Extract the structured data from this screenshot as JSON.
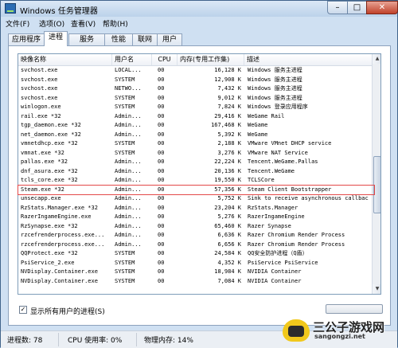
{
  "window": {
    "title": "Windows 任务管理器",
    "minimize_glyph": "–",
    "maximize_glyph": "□",
    "close_glyph": "✕"
  },
  "menu": [
    "文件(F)",
    "选项(O)",
    "查看(V)",
    "帮助(H)"
  ],
  "tabs": [
    "应用程序",
    "进程",
    "服务",
    "性能",
    "联网",
    "用户"
  ],
  "active_tab": "进程",
  "columns": {
    "name": "映像名称",
    "user": "用户名",
    "cpu": "CPU",
    "mem": "内存(专用工作集)",
    "desc": "描述"
  },
  "processes": [
    {
      "name": "svchost.exe",
      "user": "LOCAL...",
      "cpu": "00",
      "mem": "16,128 K",
      "desc": "Windows 服务主进程"
    },
    {
      "name": "svchost.exe",
      "user": "SYSTEM",
      "cpu": "00",
      "mem": "12,908 K",
      "desc": "Windows 服务主进程"
    },
    {
      "name": "svchost.exe",
      "user": "NETWO...",
      "cpu": "00",
      "mem": "7,432 K",
      "desc": "Windows 服务主进程"
    },
    {
      "name": "svchost.exe",
      "user": "SYSTEM",
      "cpu": "00",
      "mem": "9,012 K",
      "desc": "Windows 服务主进程"
    },
    {
      "name": "winlogon.exe",
      "user": "SYSTEM",
      "cpu": "00",
      "mem": "7,824 K",
      "desc": "Windows 登录应用程序"
    },
    {
      "name": "rail.exe *32",
      "user": "Admin...",
      "cpu": "00",
      "mem": "29,416 K",
      "desc": "WeGame Rail"
    },
    {
      "name": "tgp_daemon.exe *32",
      "user": "Admin...",
      "cpu": "00",
      "mem": "167,468 K",
      "desc": "WeGame"
    },
    {
      "name": "net_daemon.exe *32",
      "user": "Admin...",
      "cpu": "00",
      "mem": "5,392 K",
      "desc": "WeGame"
    },
    {
      "name": "vmnetdhcp.exe *32",
      "user": "SYSTEM",
      "cpu": "00",
      "mem": "2,188 K",
      "desc": "VMware VMnet DHCP service"
    },
    {
      "name": "vmnat.exe *32",
      "user": "SYSTEM",
      "cpu": "00",
      "mem": "3,276 K",
      "desc": "VMware NAT Service"
    },
    {
      "name": "pallas.exe *32",
      "user": "Admin...",
      "cpu": "00",
      "mem": "22,224 K",
      "desc": "Tencent.WeGame.Pallas"
    },
    {
      "name": "dnf_asura.exe *32",
      "user": "Admin...",
      "cpu": "00",
      "mem": "20,136 K",
      "desc": "Tencent.WeGame"
    },
    {
      "name": "tcls_core.exe *32",
      "user": "Admin...",
      "cpu": "00",
      "mem": "19,550 K",
      "desc": "TCLSCore"
    },
    {
      "name": "Steam.exe *32",
      "user": "Admin...",
      "cpu": "00",
      "mem": "57,356 K",
      "desc": "Steam Client Bootstrapper"
    },
    {
      "name": "unsecapp.exe",
      "user": "Admin...",
      "cpu": "00",
      "mem": "5,752 K",
      "desc": "Sink to receive asynchronous callbac"
    },
    {
      "name": "RzStats.Manager.exe *32",
      "user": "Admin...",
      "cpu": "00",
      "mem": "23,204 K",
      "desc": "RzStats.Manager"
    },
    {
      "name": "RazerIngameEngine.exe",
      "user": "Admin...",
      "cpu": "00",
      "mem": "5,276 K",
      "desc": "RazerIngameEngine"
    },
    {
      "name": "RzSynapse.exe *32",
      "user": "Admin...",
      "cpu": "00",
      "mem": "65,460 K",
      "desc": "Razer Synapse"
    },
    {
      "name": "rzcefrenderprocess.exe...",
      "user": "Admin...",
      "cpu": "00",
      "mem": "6,636 K",
      "desc": "Razer Chromium Render Process"
    },
    {
      "name": "rzcefrenderprocess.exe...",
      "user": "Admin...",
      "cpu": "00",
      "mem": "6,656 K",
      "desc": "Razer Chromium Render Process"
    },
    {
      "name": "QQProtect.exe *32",
      "user": "SYSTEM",
      "cpu": "00",
      "mem": "24,584 K",
      "desc": "QQ安全防护进程（Q盾）"
    },
    {
      "name": "PsiService_2.exe",
      "user": "SYSTEM",
      "cpu": "00",
      "mem": "4,352 K",
      "desc": "PsiService PsiService"
    },
    {
      "name": "NVDisplay.Container.exe",
      "user": "SYSTEM",
      "cpu": "00",
      "mem": "18,984 K",
      "desc": "NVIDIA Container"
    },
    {
      "name": "NVDisplay.Container.exe",
      "user": "SYSTEM",
      "cpu": "00",
      "mem": "7,084 K",
      "desc": "NVIDIA Container"
    }
  ],
  "highlighted_process": "Steam.exe *32",
  "scroll": {
    "up_glyph": "▲",
    "down_glyph": "▼"
  },
  "show_all_users": {
    "label": "显示所有用户的进程(S)",
    "checked": true,
    "glyph": "✓"
  },
  "status": {
    "processes": "进程数: 78",
    "cpu": "CPU 使用率: 0%",
    "memory": "物理内存: 14%"
  },
  "watermark": {
    "text": "三公子游戏网",
    "url": "sangongzi.net"
  }
}
